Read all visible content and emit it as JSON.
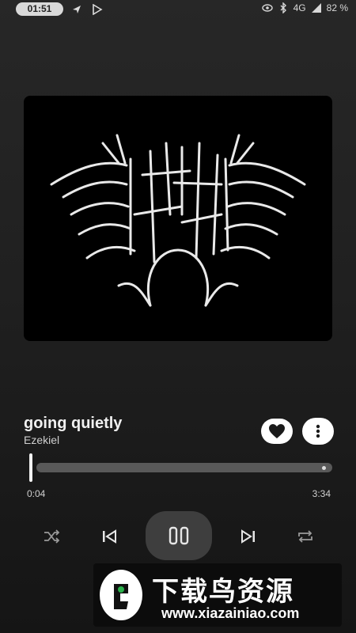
{
  "status_bar": {
    "time": "01:51",
    "network": "4G",
    "battery": "82 %",
    "icons": [
      "navigation-arrow-icon",
      "play-store-icon",
      "eye-icon",
      "bluetooth-icon",
      "signal-icon",
      "battery-icon"
    ]
  },
  "track": {
    "title": "going quietly",
    "artist": "Ezekiel",
    "cover_art": "Ezekiel metal-style logo artwork"
  },
  "player": {
    "current_time": "0:04",
    "total_time": "3:34",
    "progress_fraction": 0.02
  },
  "controls": {
    "shuffle": "shuffle-icon",
    "previous": "previous-icon",
    "play_pause": "pause-icon",
    "next": "next-icon",
    "repeat": "repeat-icon"
  },
  "actions": {
    "favorite": "heart-icon",
    "more": "more-vertical-icon"
  },
  "watermark": {
    "brand": "下载鸟资源",
    "url": "www.xiazainiao.com"
  },
  "colors": {
    "background": "#202020",
    "track_bar": "#595959",
    "accent": "#ffffff"
  }
}
